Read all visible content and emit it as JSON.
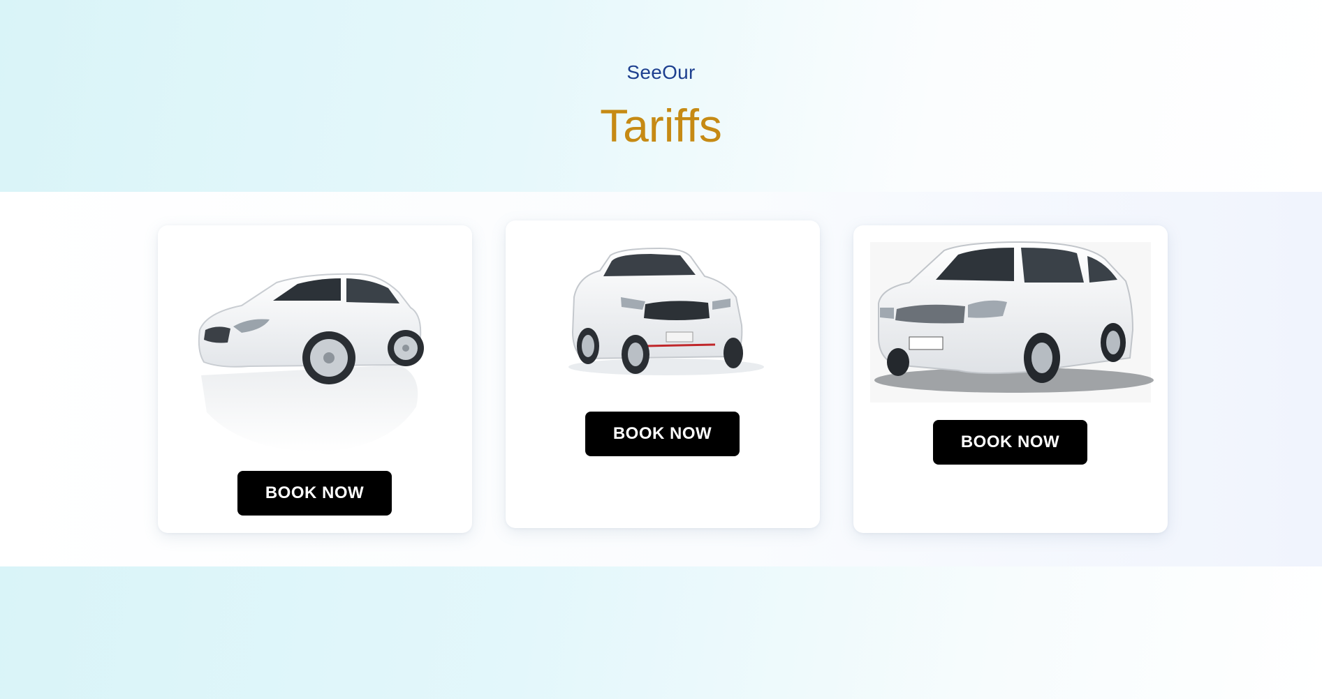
{
  "header": {
    "eyebrow": "SeeOur",
    "title": "Tariffs"
  },
  "cards": [
    {
      "car_icon": "hatchback-car-icon",
      "button_label": "BOOK NOW"
    },
    {
      "car_icon": "suv-car-icon",
      "button_label": "BOOK NOW"
    },
    {
      "car_icon": "mpv-car-icon",
      "button_label": "BOOK NOW"
    }
  ],
  "colors": {
    "eyebrow": "#1d3f8f",
    "title": "#c68a14",
    "button_bg": "#000000",
    "button_text": "#ffffff"
  }
}
